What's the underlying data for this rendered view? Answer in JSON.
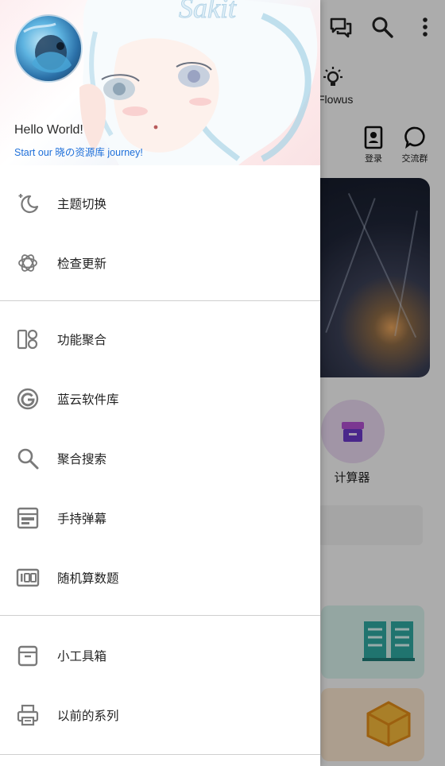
{
  "background": {
    "tab_label": "Flowus",
    "shortcuts": [
      {
        "label": "登录",
        "icon": "contact-card-icon"
      },
      {
        "label": "交流群",
        "icon": "chat-bubble-icon"
      }
    ],
    "grid_item_label": "计算器",
    "toolbar_icons": [
      "chat-icon",
      "search-icon",
      "more-vert-icon"
    ]
  },
  "drawer": {
    "header": {
      "title": "Hello World!",
      "subtitle": "Start our 晓の资源库 journey!",
      "watermark": "Sakit"
    },
    "groups": [
      [
        {
          "label": "主题切换",
          "icon": "moon-icon"
        },
        {
          "label": "检查更新",
          "icon": "openai-icon"
        }
      ],
      [
        {
          "label": "功能聚合",
          "icon": "grid-tiles-icon"
        },
        {
          "label": "蓝云软件库",
          "icon": "g-logo-icon"
        },
        {
          "label": "聚合搜索",
          "icon": "search-icon"
        },
        {
          "label": "手持弹幕",
          "icon": "screen-text-icon"
        },
        {
          "label": "随机算数题",
          "icon": "number-board-icon"
        }
      ],
      [
        {
          "label": "小工具箱",
          "icon": "archive-box-icon"
        },
        {
          "label": "以前的系列",
          "icon": "printer-icon"
        }
      ]
    ]
  },
  "colors": {
    "subtitle_link": "#1e6fd9",
    "icon_gray": "#7a7a7a",
    "divider": "#cfcfcf"
  }
}
